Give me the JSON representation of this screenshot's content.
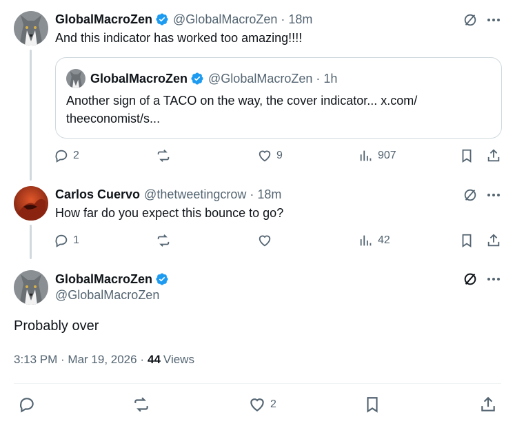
{
  "colors": {
    "accent": "#1d9bf0",
    "text": "#0f1419",
    "muted": "#536471",
    "border": "#cfd9de"
  },
  "tweet1": {
    "name": "GlobalMacroZen",
    "handle": "@GlobalMacroZen",
    "time": "· 18m",
    "text": "And this indicator has worked too amazing!!!!",
    "quote": {
      "name": "GlobalMacroZen",
      "handle": "@GlobalMacroZen",
      "time": "· 1h",
      "text_line1": "Another sign of a TACO on the way, the cover indicator... x.com/",
      "text_line2": "theeconomist/s..."
    },
    "stats": {
      "replies": "2",
      "reposts": "",
      "likes": "9",
      "views": "907"
    }
  },
  "tweet2": {
    "name": "Carlos Cuervo",
    "handle": "@thetweetingcrow",
    "time": "· 18m",
    "text": "How far do you expect this bounce to go?",
    "stats": {
      "replies": "1",
      "reposts": "",
      "likes": "",
      "views": "42"
    }
  },
  "main": {
    "name": "GlobalMacroZen",
    "handle": "@GlobalMacroZen",
    "text": "Probably over",
    "time": "3:13 PM · Mar 19, 2026 ·",
    "views_count": "44",
    "views_label": "Views",
    "stats": {
      "replies": "",
      "reposts": "",
      "likes": "2",
      "bookmarks": ""
    }
  },
  "icons": [
    "grok-icon",
    "more-icon",
    "verified-badge-icon",
    "reply-icon",
    "repost-icon",
    "like-icon",
    "views-icon",
    "bookmark-icon",
    "share-icon"
  ]
}
